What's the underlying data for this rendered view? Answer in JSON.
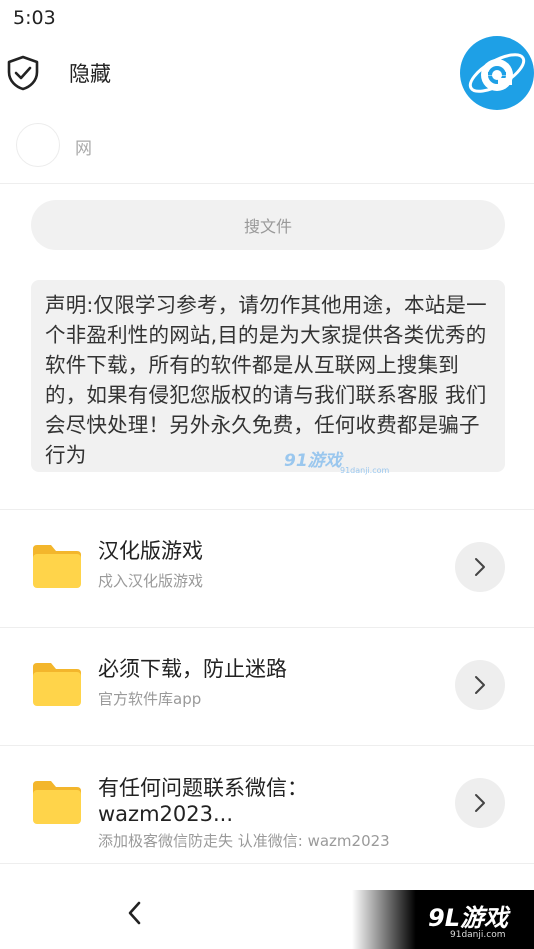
{
  "status_bar": {
    "time": "5:03"
  },
  "header": {
    "title": "隐藏",
    "icons": [
      "shield-check-icon",
      "internet-explorer-icon"
    ]
  },
  "user": {
    "name": "网"
  },
  "search": {
    "placeholder": "搜文件"
  },
  "notice": {
    "text": "声明:仅限学习参考，请勿作其他用途，本站是一个非盈利性的网站,目的是为大家提供各类优秀的软件下载，所有的软件都是从互联网上搜集到的，如果有侵犯您版权的请与我们联系客服 我们会尽快处理！另外永久免费，任何收费都是骗子行为"
  },
  "watermark": {
    "logo": "91游戏",
    "url": "91danji.com"
  },
  "items": [
    {
      "title": "汉化版游戏",
      "subtitle": "戍入汉化版游戏"
    },
    {
      "title": "必须下载，防止迷路",
      "subtitle": "官方软件库app"
    },
    {
      "title": "有任何问题联系微信：wazm2023...",
      "subtitle": "添加极客微信防走失 认准微信: wazm2023"
    }
  ],
  "nav": {
    "back_icon": "chevron-left-icon",
    "logo": "9L游戏",
    "logo_url": "91danji.com"
  },
  "colors": {
    "folder": "#ffd44a",
    "folder_tab": "#f3b62c",
    "browser_blue": "#1ea0e6"
  }
}
